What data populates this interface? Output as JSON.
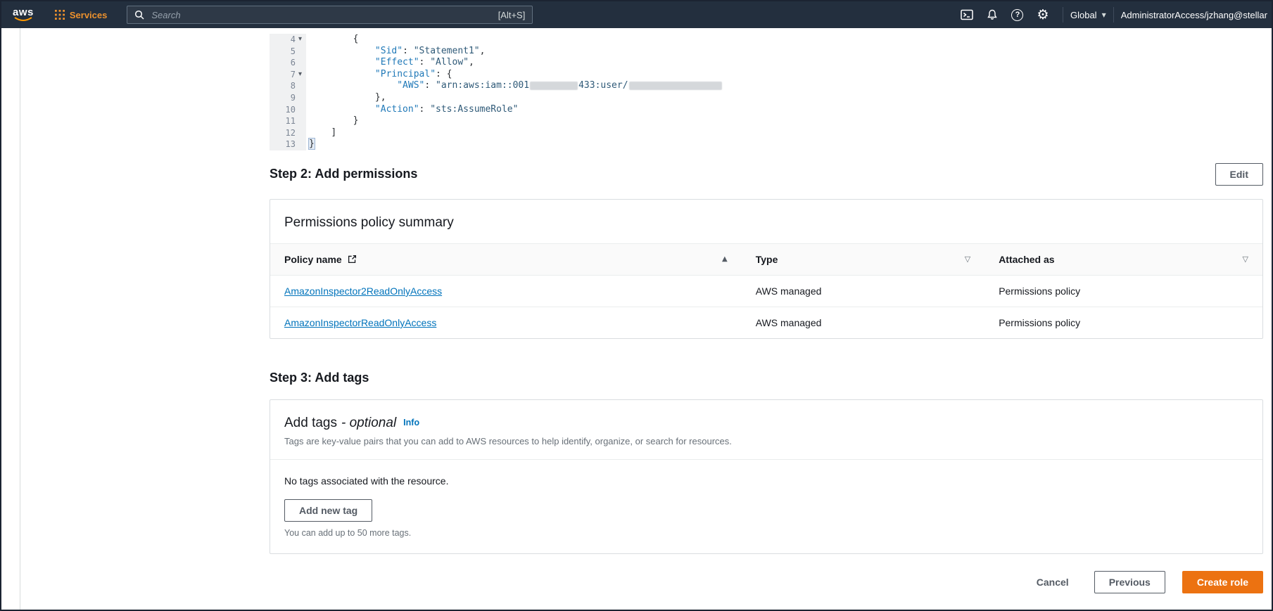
{
  "topnav": {
    "logo_text": "aws",
    "services": "Services",
    "search": {
      "placeholder": "Search",
      "shortcut": "[Alt+S]"
    },
    "region": "Global",
    "region_caret": "▼",
    "account": "AdministratorAccess/jzhang@stellar"
  },
  "editor": {
    "lines": [
      {
        "num": "4",
        "fold": "▾",
        "indent": "        ",
        "p1": "{"
      },
      {
        "num": "5",
        "fold": "",
        "indent": "            ",
        "key": "\"Sid\"",
        "colon": ": ",
        "val": "\"Statement1\"",
        "comma": ","
      },
      {
        "num": "6",
        "fold": "",
        "indent": "            ",
        "key": "\"Effect\"",
        "colon": ": ",
        "val": "\"Allow\"",
        "comma": ","
      },
      {
        "num": "7",
        "fold": "▾",
        "indent": "            ",
        "key": "\"Principal\"",
        "colon": ": ",
        "brace": "{"
      },
      {
        "num": "8",
        "fold": "",
        "indent": "                ",
        "key": "\"AWS\"",
        "colon": ": ",
        "val1": "\"arn:aws:iam::001",
        "val2": "433:user/"
      },
      {
        "num": "9",
        "fold": "",
        "indent": "            ",
        "p1": "},"
      },
      {
        "num": "10",
        "fold": "",
        "indent": "            ",
        "key": "\"Action\"",
        "colon": ": ",
        "val": "\"sts:AssumeRole\""
      },
      {
        "num": "11",
        "fold": "",
        "indent": "        ",
        "p1": "}"
      },
      {
        "num": "12",
        "fold": "",
        "indent": "    ",
        "p1": "]"
      },
      {
        "num": "13",
        "fold": "",
        "indent": "",
        "p1": "}"
      }
    ]
  },
  "step2": {
    "heading": "Step 2: Add permissions",
    "edit_button": "Edit"
  },
  "permissions": {
    "title": "Permissions policy summary",
    "columns": {
      "policy_name": "Policy name",
      "type": "Type",
      "attached_as": "Attached as"
    },
    "sort_icon": "▲",
    "filter_icon": "▽",
    "rows": [
      {
        "policy_name": "AmazonInspector2ReadOnlyAccess",
        "type": "AWS managed",
        "attached_as": "Permissions policy"
      },
      {
        "policy_name": "AmazonInspectorReadOnlyAccess",
        "type": "AWS managed",
        "attached_as": "Permissions policy"
      }
    ]
  },
  "step3": {
    "heading": "Step 3: Add tags"
  },
  "tags": {
    "title": "Add tags",
    "title_suffix": "- optional",
    "info_link": "Info",
    "description": "Tags are key-value pairs that you can add to AWS resources to help identify, organize, or search for resources.",
    "empty_text": "No tags associated with the resource.",
    "add_button": "Add new tag",
    "hint": "You can add up to 50 more tags."
  },
  "footer": {
    "cancel": "Cancel",
    "previous": "Previous",
    "create": "Create role"
  },
  "colors": {
    "accent": "#ec7211",
    "link": "#0073bb",
    "nav_bg": "#232f3e"
  }
}
